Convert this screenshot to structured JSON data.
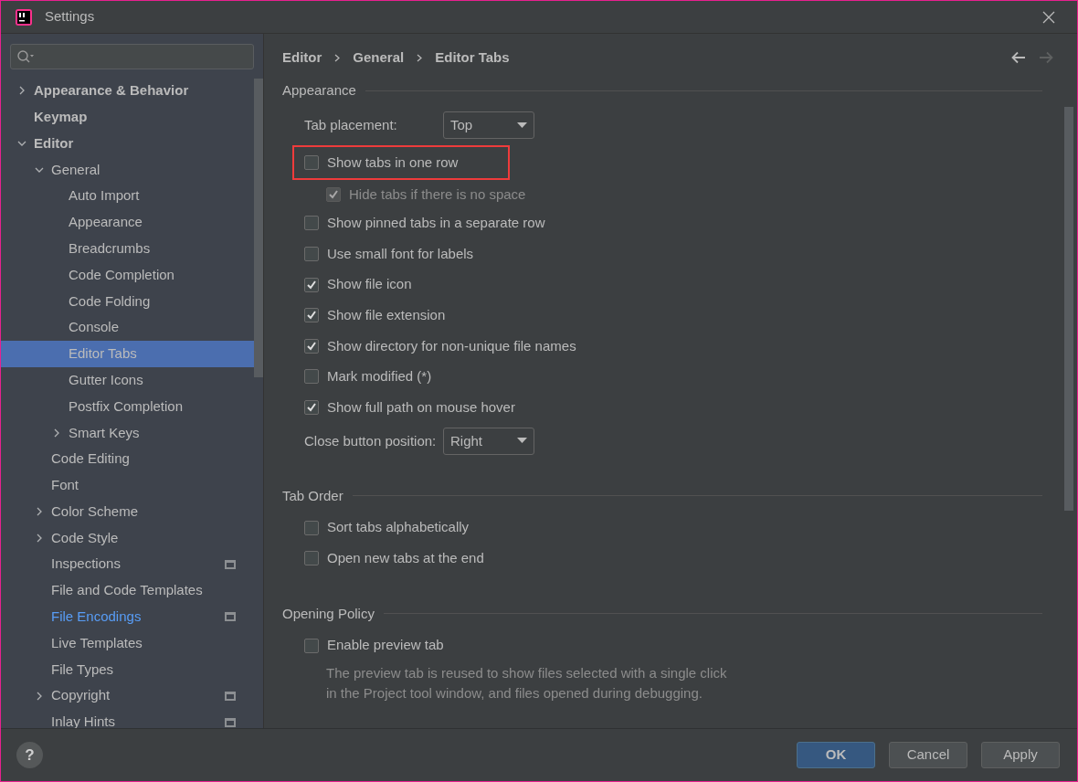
{
  "window": {
    "title": "Settings"
  },
  "tree": [
    {
      "label": "Appearance & Behavior",
      "expanded": false,
      "selected": false
    },
    {
      "label": "Keymap",
      "selected": false
    },
    {
      "label": "Editor",
      "expanded": true,
      "selected": false,
      "children": [
        {
          "label": "General",
          "expanded": true,
          "selected": false,
          "children": [
            {
              "label": "Auto Import",
              "selected": false
            },
            {
              "label": "Appearance",
              "selected": false
            },
            {
              "label": "Breadcrumbs",
              "selected": false
            },
            {
              "label": "Code Completion",
              "selected": false
            },
            {
              "label": "Code Folding",
              "selected": false
            },
            {
              "label": "Console",
              "selected": false
            },
            {
              "label": "Editor Tabs",
              "selected": true
            },
            {
              "label": "Gutter Icons",
              "selected": false
            },
            {
              "label": "Postfix Completion",
              "selected": false
            },
            {
              "label": "Smart Keys",
              "expanded": false,
              "selected": false
            }
          ]
        },
        {
          "label": "Code Editing",
          "selected": false
        },
        {
          "label": "Font",
          "selected": false
        },
        {
          "label": "Color Scheme",
          "expanded": false,
          "selected": false
        },
        {
          "label": "Code Style",
          "expanded": false,
          "selected": false
        },
        {
          "label": "Inspections",
          "selected": false,
          "project_scope": true
        },
        {
          "label": "File and Code Templates",
          "selected": false
        },
        {
          "label": "File Encodings",
          "selected": false,
          "modified": true,
          "project_scope": true
        },
        {
          "label": "Live Templates",
          "selected": false
        },
        {
          "label": "File Types",
          "selected": false
        },
        {
          "label": "Copyright",
          "expanded": false,
          "selected": false,
          "project_scope": true
        },
        {
          "label": "Inlay Hints",
          "selected": false,
          "project_scope": true
        }
      ]
    }
  ],
  "breadcrumbs": [
    "Editor",
    "General",
    "Editor Tabs"
  ],
  "nav": {
    "back_enabled": true,
    "forward_enabled": false
  },
  "sections": [
    {
      "title": "Appearance",
      "items": [
        {
          "kind": "dropdown",
          "label": "Tab placement:",
          "value": "Top"
        },
        {
          "kind": "checkbox",
          "label": "Show tabs in one row",
          "checked": false,
          "disabled": false,
          "highlighted": true
        },
        {
          "kind": "subcheckbox",
          "label": "Hide tabs if there is no space",
          "checked": true,
          "disabled": true
        },
        {
          "kind": "checkbox",
          "label": "Show pinned tabs in a separate row",
          "checked": false,
          "disabled": false
        },
        {
          "kind": "checkbox",
          "label": "Use small font for labels",
          "checked": false,
          "disabled": false
        },
        {
          "kind": "checkbox",
          "label": "Show file icon",
          "checked": true,
          "disabled": false
        },
        {
          "kind": "checkbox",
          "label": "Show file extension",
          "checked": true,
          "disabled": false
        },
        {
          "kind": "checkbox",
          "label": "Show directory for non-unique file names",
          "checked": true,
          "disabled": false
        },
        {
          "kind": "checkbox",
          "label": "Mark modified (*)",
          "checked": false,
          "disabled": false
        },
        {
          "kind": "checkbox",
          "label": "Show full path on mouse hover",
          "checked": true,
          "disabled": false
        },
        {
          "kind": "dropdown",
          "label": "Close button position:",
          "value": "Right"
        }
      ]
    },
    {
      "title": "Tab Order",
      "items": [
        {
          "kind": "checkbox",
          "label": "Sort tabs alphabetically",
          "checked": false,
          "disabled": false
        },
        {
          "kind": "checkbox",
          "label": "Open new tabs at the end",
          "checked": false,
          "disabled": false
        }
      ]
    },
    {
      "title": "Opening Policy",
      "items": [
        {
          "kind": "checkbox",
          "label": "Enable preview tab",
          "checked": false,
          "disabled": false
        },
        {
          "kind": "note",
          "lines": [
            "The preview tab is reused to show files selected with a single click",
            "in the Project tool window, and files opened during debugging."
          ]
        }
      ]
    }
  ],
  "help": {
    "label": "?"
  },
  "buttons": [
    {
      "label": "OK",
      "default": true
    },
    {
      "label": "Cancel",
      "default": false
    },
    {
      "label": "Apply",
      "default": false
    }
  ]
}
